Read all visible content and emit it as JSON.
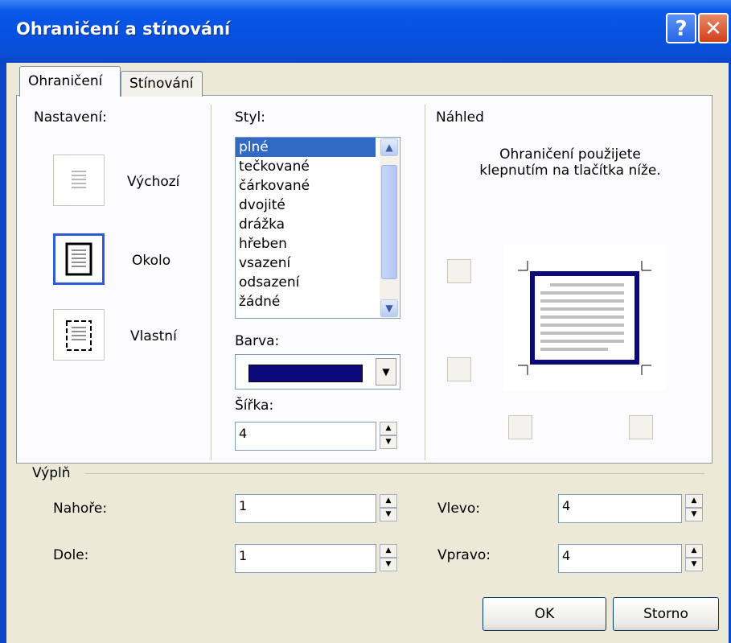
{
  "window": {
    "title": "Ohraničení a stínování",
    "help_icon": "?",
    "close_icon": "✕"
  },
  "tabs": [
    {
      "label": "Ohraničení",
      "active": true
    },
    {
      "label": "Stínování",
      "active": false
    }
  ],
  "settings": {
    "heading": "Nastavení:",
    "options": [
      {
        "label": "Výchozí",
        "selected": false
      },
      {
        "label": "Okolo",
        "selected": true
      },
      {
        "label": "Vlastní",
        "selected": false
      }
    ]
  },
  "style": {
    "label": "Styl:",
    "items": [
      "plné",
      "tečkované",
      "čárkované",
      "dvojité",
      "drážka",
      "hřeben",
      "vsazení",
      "odsazení",
      "žádné"
    ],
    "selected": "plné"
  },
  "color": {
    "label": "Barva:",
    "value": "#0a0a7a"
  },
  "width": {
    "label": "Šířka:",
    "value": "4"
  },
  "preview": {
    "heading": "Náhled",
    "hint_line1": "Ohraničení použijete",
    "hint_line2": "klepnutím na tlačítka níže."
  },
  "padding": {
    "heading": "Výplň",
    "top": {
      "label": "Nahoře:",
      "value": "1"
    },
    "bottom": {
      "label": "Dole:",
      "value": "1"
    },
    "left": {
      "label": "Vlevo:",
      "value": "4"
    },
    "right": {
      "label": "Vpravo:",
      "value": "4"
    }
  },
  "buttons": {
    "ok": "OK",
    "cancel": "Storno"
  }
}
